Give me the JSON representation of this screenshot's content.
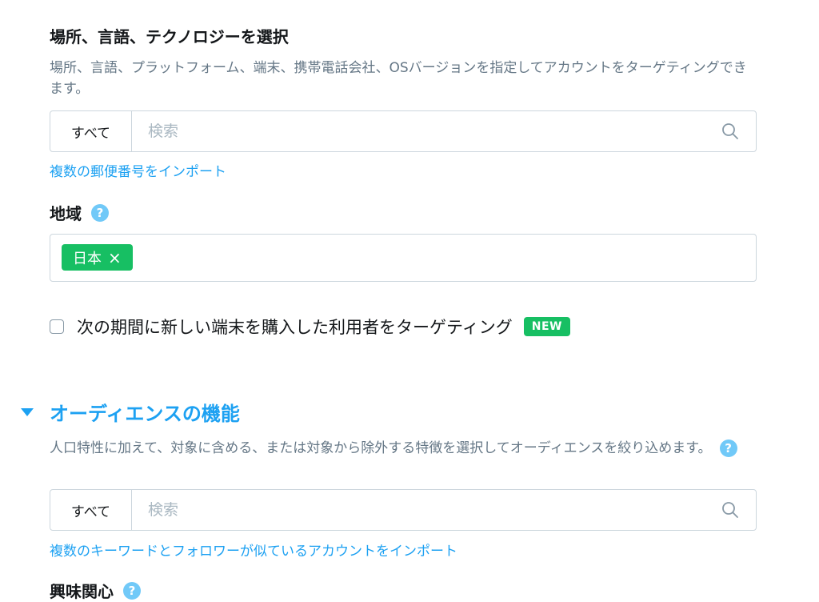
{
  "location_section": {
    "title": "場所、言語、テクノロジーを選択",
    "description": "場所、言語、プラットフォーム、端末、携帯電話会社、OSバージョンを指定してアカウントをターゲティングできます。",
    "search": {
      "scope_label": "すべて",
      "placeholder": "検索"
    },
    "import_link": "複数の郵便番号をインポート"
  },
  "region": {
    "label": "地域",
    "tokens": [
      {
        "label": "日本",
        "remove_glyph": "×"
      }
    ]
  },
  "new_device": {
    "label": "次の期間に新しい端末を購入した利用者をターゲティング",
    "badge": "NEW",
    "badge_color": "#17bf63"
  },
  "audience_section": {
    "title": "オーディエンスの機能",
    "description": "人口特性に加えて、対象に含める、または対象から除外する特徴を選択してオーディエンスを絞り込めます。",
    "search": {
      "scope_label": "すべて",
      "placeholder": "検索"
    },
    "import_link": "複数のキーワードとフォロワーが似ているアカウントをインポート"
  },
  "interests": {
    "label": "興味関心"
  },
  "icons": {
    "help": "?",
    "search": "search-icon",
    "expand": "triangle-down-icon"
  },
  "colors": {
    "accent": "#1da1f2",
    "success": "#17bf63",
    "help": "#71c9f8",
    "muted": "#657786"
  }
}
